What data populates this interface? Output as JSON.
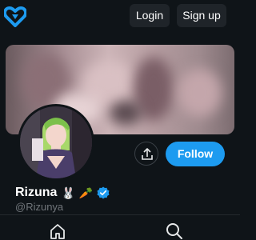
{
  "header": {
    "logo_icon": "heart-logo-icon",
    "login_label": "Login",
    "signup_label": "Sign up"
  },
  "profile": {
    "banner": "blurred-banner-image",
    "avatar": "profile-avatar-image",
    "share_icon": "share-icon",
    "follow_label": "Follow",
    "display_name": "Rizuna",
    "name_emoji_1": "🐰",
    "name_emoji_2": "🥕",
    "verified_icon": "verified-badge-icon",
    "handle": "@Rizunya"
  },
  "bottom_nav": {
    "home_icon": "home-icon",
    "search_icon": "search-icon"
  },
  "colors": {
    "background": "#0f1418",
    "accent": "#1d9bf0",
    "logo": "#1d9bf0",
    "muted_text": "#71767b"
  }
}
